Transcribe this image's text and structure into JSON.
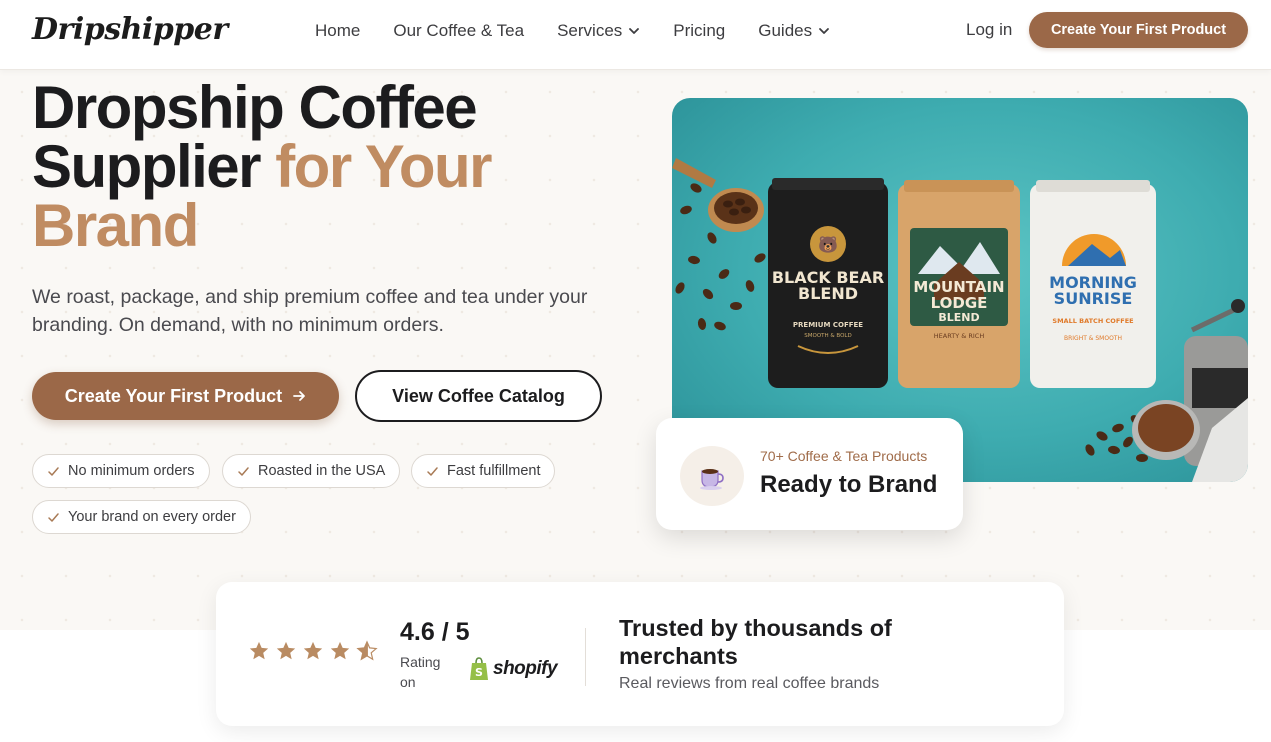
{
  "brand": {
    "logo_text": "Dripshipper"
  },
  "nav": {
    "items": [
      {
        "label": "Home",
        "has_dropdown": false
      },
      {
        "label": "Our Coffee & Tea",
        "has_dropdown": false
      },
      {
        "label": "Services",
        "has_dropdown": true
      },
      {
        "label": "Pricing",
        "has_dropdown": false
      },
      {
        "label": "Guides",
        "has_dropdown": true
      }
    ],
    "login_label": "Log in",
    "cta_label": "Create Your First Product"
  },
  "hero": {
    "title_line1": "Dropship Coffee",
    "title_line2_plain": "Supplier ",
    "title_line2_accent": "for Your",
    "title_line3_accent": "Brand",
    "subtitle": "We roast, package, and ship premium coffee and tea under your branding. On demand, with no minimum orders.",
    "primary_button": "Create Your First Product",
    "primary_button_icon": "arrow-right-icon",
    "secondary_button": "View Coffee Catalog",
    "features": [
      "No minimum orders",
      "Roasted in the USA",
      "Fast fulfillment",
      "Your brand on every order"
    ]
  },
  "product_image": {
    "bags": [
      {
        "name_line1": "BLACK BEAR",
        "name_line2": "BLEND",
        "tag1": "PREMIUM COFFEE",
        "tag2": "SMOOTH & BOLD"
      },
      {
        "name_line1": "MOUNTAIN",
        "name_line2": "LODGE",
        "name_line3": "BLEND",
        "tag1": "HEARTY & RICH"
      },
      {
        "name_line1": "MORNING",
        "name_line2": "SUNRISE",
        "tag1": "SMALL BATCH COFFEE",
        "tag2": "BRIGHT & SMOOTH"
      }
    ]
  },
  "ready_card": {
    "icon": "coffee-cup-icon",
    "small_text": "70+ Coffee & Tea Products",
    "big_text": "Ready to Brand"
  },
  "trust": {
    "rating_value": 4.6,
    "rating_text": "4.6 / 5",
    "rating_label": "Rating on",
    "platform": "shopify",
    "title": "Trusted by thousands of merchants",
    "subtitle": "Real reviews from real coffee brands"
  },
  "colors": {
    "accent": "#9b6848",
    "accent_text": "#c08c62",
    "teal_background": "#3eacb0",
    "star": "#b98b62"
  }
}
